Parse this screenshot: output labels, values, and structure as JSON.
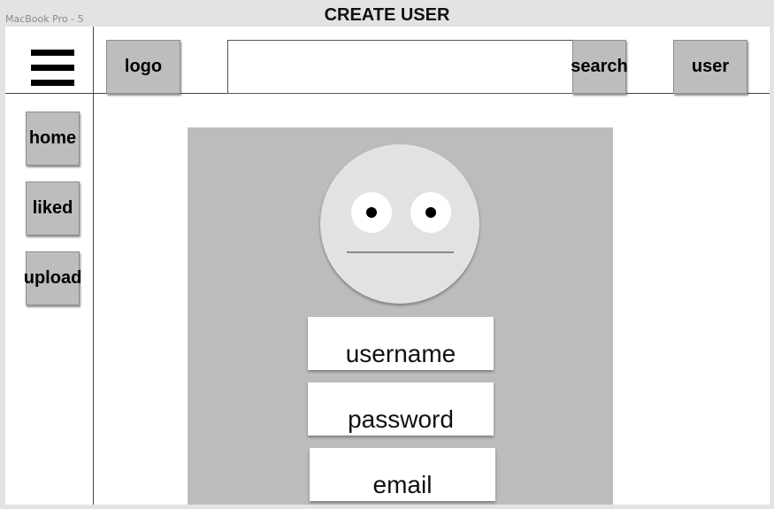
{
  "window": {
    "frame_label": "MacBook Pro - 5",
    "title": "CREATE USER"
  },
  "header": {
    "menu_icon": "hamburger-menu-icon",
    "logo_label": "logo",
    "search": {
      "value": "",
      "button_label": "search"
    },
    "user_label": "user"
  },
  "sidebar": {
    "items": [
      {
        "label": "home"
      },
      {
        "label": "liked"
      },
      {
        "label": "upload"
      }
    ]
  },
  "form": {
    "avatar_icon": "neutral-face-icon",
    "fields": [
      {
        "label": "username"
      },
      {
        "label": "password"
      },
      {
        "label": "email"
      }
    ]
  },
  "colors": {
    "background": "#e3e3e3",
    "panel": "#bcbcbc",
    "button": "#bdbdbd",
    "avatar": "#e2e2e2"
  }
}
